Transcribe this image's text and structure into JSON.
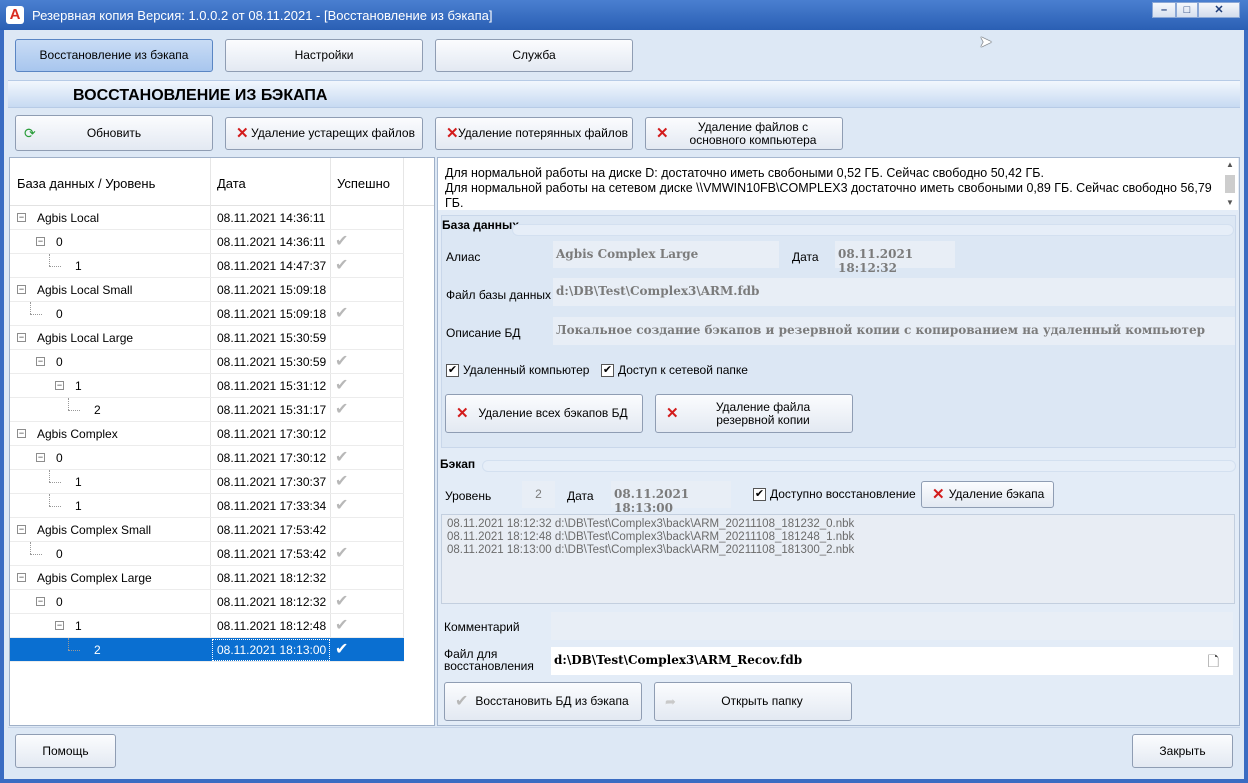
{
  "window": {
    "title": "Резервная копия   Версия: 1.0.0.2 от 08.11.2021 - [Восстановление из бэкапа]",
    "logo": "A",
    "controls": [
      "minimize",
      "maximize",
      "close"
    ]
  },
  "tabs": [
    {
      "label": "Восстановление из бэкапа",
      "active": true
    },
    {
      "label": "Настройки",
      "active": false
    },
    {
      "label": "Служба",
      "active": false
    }
  ],
  "section_title": "ВОССТАНОВЛЕНИЕ ИЗ БЭКАПА",
  "toolbar": {
    "refresh": "Обновить",
    "delete_old": "Удаление устарещих файлов",
    "delete_lost": "Удаление потерянных файлов",
    "delete_main": "Удаление файлов с основного компьютера"
  },
  "tree": {
    "headers": {
      "name": "База данных / Уровень",
      "date": "Дата",
      "success": "Успешно"
    },
    "rows": [
      {
        "name": "Agbis Local",
        "date": "08.11.2021 14:36:11",
        "ok": ""
      },
      {
        "name": "0",
        "date": "08.11.2021 14:36:11",
        "ok": "✔"
      },
      {
        "name": "1",
        "date": "08.11.2021 14:47:37",
        "ok": "✔"
      },
      {
        "name": "Agbis Local Small",
        "date": "08.11.2021 15:09:18",
        "ok": ""
      },
      {
        "name": "0",
        "date": "08.11.2021 15:09:18",
        "ok": "✔"
      },
      {
        "name": "Agbis Local Large",
        "date": "08.11.2021 15:30:59",
        "ok": ""
      },
      {
        "name": "0",
        "date": "08.11.2021 15:30:59",
        "ok": "✔"
      },
      {
        "name": "1",
        "date": "08.11.2021 15:31:12",
        "ok": "✔"
      },
      {
        "name": "2",
        "date": "08.11.2021 15:31:17",
        "ok": "✔"
      },
      {
        "name": "Agbis Complex",
        "date": "08.11.2021 17:30:12",
        "ok": ""
      },
      {
        "name": "0",
        "date": "08.11.2021 17:30:12",
        "ok": "✔"
      },
      {
        "name": "1",
        "date": "08.11.2021 17:30:37",
        "ok": "✔"
      },
      {
        "name": "1",
        "date": "08.11.2021 17:33:34",
        "ok": "✔"
      },
      {
        "name": "Agbis Complex Small",
        "date": "08.11.2021 17:53:42",
        "ok": ""
      },
      {
        "name": "0",
        "date": "08.11.2021 17:53:42",
        "ok": "✔"
      },
      {
        "name": "Agbis Complex Large",
        "date": "08.11.2021 18:12:32",
        "ok": ""
      },
      {
        "name": "0",
        "date": "08.11.2021 18:12:32",
        "ok": "✔"
      },
      {
        "name": "1",
        "date": "08.11.2021 18:12:48",
        "ok": "✔"
      },
      {
        "name": "2",
        "date": "08.11.2021 18:13:00",
        "ok": "✔"
      }
    ]
  },
  "info": {
    "line1": "Для нормальной работы на диске D: достаточно иметь свобоными 0,52 ГБ. Сейчас свободно 50,42 ГБ.",
    "line2": "Для нормальной работы на сетевом диске \\\\VMWIN10FB\\COMPLEX3 достаточно иметь свобоными 0,89 ГБ. Сейчас свободно 56,79",
    "line3": "ГБ."
  },
  "db": {
    "title": "База данных",
    "alias_label": "Алиас",
    "alias": "Agbis Complex Large",
    "date_label": "Дата",
    "date": "08.11.2021 18:12:32",
    "file_label": "Файл базы данных",
    "file": "d:\\DB\\Test\\Complex3\\ARM.fdb",
    "desc_label": "Описание БД",
    "desc": "Локальное создание бэкапов и резервной копии с копированием на удаленный компьютер",
    "remote_label": "Удаленный компьютер",
    "share_label": "Доступ к сетевой папке",
    "delete_all": "Удаление всех бэкапов БД",
    "delete_reserve": "Удаление файла резервной копии"
  },
  "backup": {
    "title": "Бэкап",
    "level_label": "Уровень",
    "level": "2",
    "date_label": "Дата",
    "date": "08.11.2021 18:13:00",
    "restore_avail_label": "Доступно восстановление",
    "delete_backup": "Удаление бэкапа",
    "log": [
      "08.11.2021 18:12:32 d:\\DB\\Test\\Complex3\\back\\ARM_20211108_181232_0.nbk",
      "08.11.2021 18:12:48 d:\\DB\\Test\\Complex3\\back\\ARM_20211108_181248_1.nbk",
      "08.11.2021 18:13:00 d:\\DB\\Test\\Complex3\\back\\ARM_20211108_181300_2.nbk"
    ],
    "comment_label": "Комментарий",
    "restore_file_label": "Файл для восстановления",
    "restore_file": "d:\\DB\\Test\\Complex3\\ARM_Recov.fdb",
    "restore_btn": "Восстановить БД из бэкапа",
    "open_folder_btn": "Открыть папку"
  },
  "footer": {
    "help": "Помощь",
    "close": "Закрыть"
  }
}
